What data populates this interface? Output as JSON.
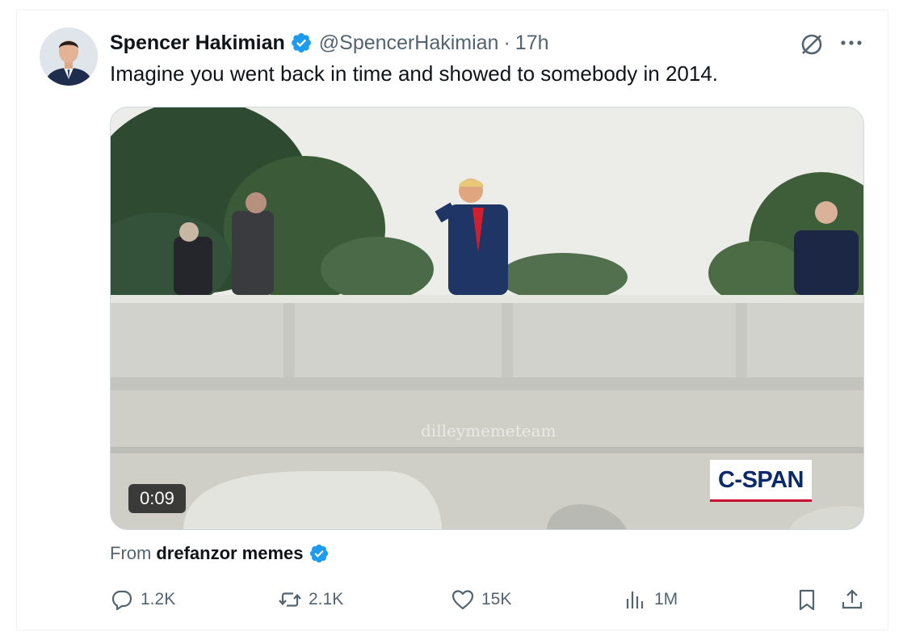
{
  "tweet": {
    "author_name": "Spencer Hakimian",
    "handle": "@SpencerHakimian",
    "separator": "·",
    "time": "17h",
    "text": "Imagine you went back in time and showed to somebody in 2014."
  },
  "media": {
    "duration": "0:09",
    "broadcaster_logo": "C-SPAN",
    "watermark": "dilleymemeteam"
  },
  "attribution": {
    "from_label": "From",
    "source_name": "drefanzor memes"
  },
  "actions": {
    "replies": "1.2K",
    "reposts": "2.1K",
    "likes": "15K",
    "views": "1M"
  },
  "icons": {
    "verified": "verified-badge-icon",
    "grok": "grok-icon",
    "more": "more-icon",
    "reply": "reply-icon",
    "repost": "repost-icon",
    "like": "like-icon",
    "views": "views-icon",
    "bookmark": "bookmark-icon",
    "share": "share-icon"
  },
  "colors": {
    "verified_blue": "#1d9bf0",
    "secondary_text": "#536471",
    "primary_text": "#0f1419",
    "cspan_navy": "#0a2a6b",
    "cspan_red": "#c8102e"
  }
}
